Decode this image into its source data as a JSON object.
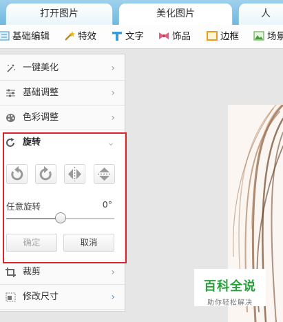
{
  "tabs": [
    {
      "label": "打开图片"
    },
    {
      "label": "美化图片"
    },
    {
      "label": "人"
    }
  ],
  "toolbar": {
    "items": [
      {
        "label": "基础编辑",
        "icon": "basic-edit-icon"
      },
      {
        "label": "特效",
        "icon": "magic-wand-icon"
      },
      {
        "label": "文字",
        "icon": "text-t-icon"
      },
      {
        "label": "饰品",
        "icon": "bow-icon"
      },
      {
        "label": "边框",
        "icon": "frame-icon"
      },
      {
        "label": "场景",
        "icon": "scene-icon"
      }
    ]
  },
  "panel": {
    "items": [
      {
        "label": "一键美化",
        "icon": "magic-stars-icon"
      },
      {
        "label": "基础调整",
        "icon": "sliders-icon"
      },
      {
        "label": "色彩调整",
        "icon": "palette-icon"
      },
      {
        "label": "旋转",
        "icon": "rotate-icon"
      },
      {
        "label": "裁剪",
        "icon": "crop-icon"
      },
      {
        "label": "修改尺寸",
        "icon": "resize-icon"
      }
    ],
    "rotate": {
      "angle_label": "任意旋转",
      "angle_value": "0°",
      "slider_fraction": 0.5,
      "ok_label": "确定",
      "cancel_label": "取消"
    }
  },
  "watermark": {
    "title": "百科全说",
    "subtitle": "助你轻松解决"
  },
  "colors": {
    "tab_bar": "#7fc1e4",
    "highlight": "#d9232a",
    "watermark_green": "#27a23a",
    "chevron_active": "#4a90d9"
  }
}
